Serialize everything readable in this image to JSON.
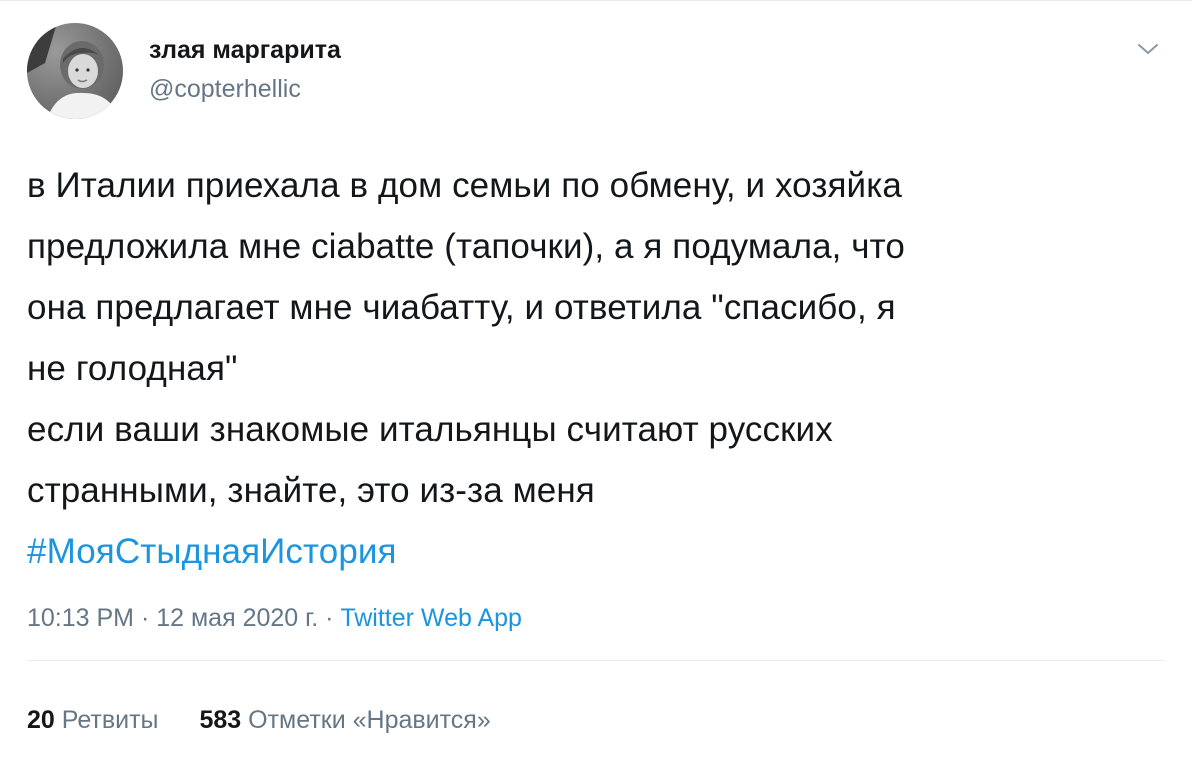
{
  "user": {
    "name": "злая маргарита",
    "handle": "@copterhellic"
  },
  "tweet": {
    "lines": [
      "в Италии приехала в дом семьи по обмену, и хозяйка",
      "предложила мне ciabatte (тапочки), а я подумала, что",
      "она предлагает мне чиабатту, и ответила \"спасибо, я",
      "не голодная\"",
      "если ваши знакомые итальянцы считают русских",
      "странными, знайте, это из-за меня"
    ],
    "hashtag": "#МояСтыднаяИстория"
  },
  "meta": {
    "time": "10:13 PM",
    "separator1": " · ",
    "date": "12 мая 2020 г.",
    "separator2": " · ",
    "source": "Twitter Web App"
  },
  "stats": {
    "retweets_count": "20",
    "retweets_label": "Ретвиты",
    "likes_count": "583",
    "likes_label": "Отметки «Нравится»"
  },
  "colors": {
    "link": "#1b95e0",
    "secondary_text": "#657786",
    "primary_text": "#14171a",
    "divider": "#e6ecf0"
  },
  "icons": {
    "caret": "chevron-down-icon",
    "avatar": "avatar"
  }
}
